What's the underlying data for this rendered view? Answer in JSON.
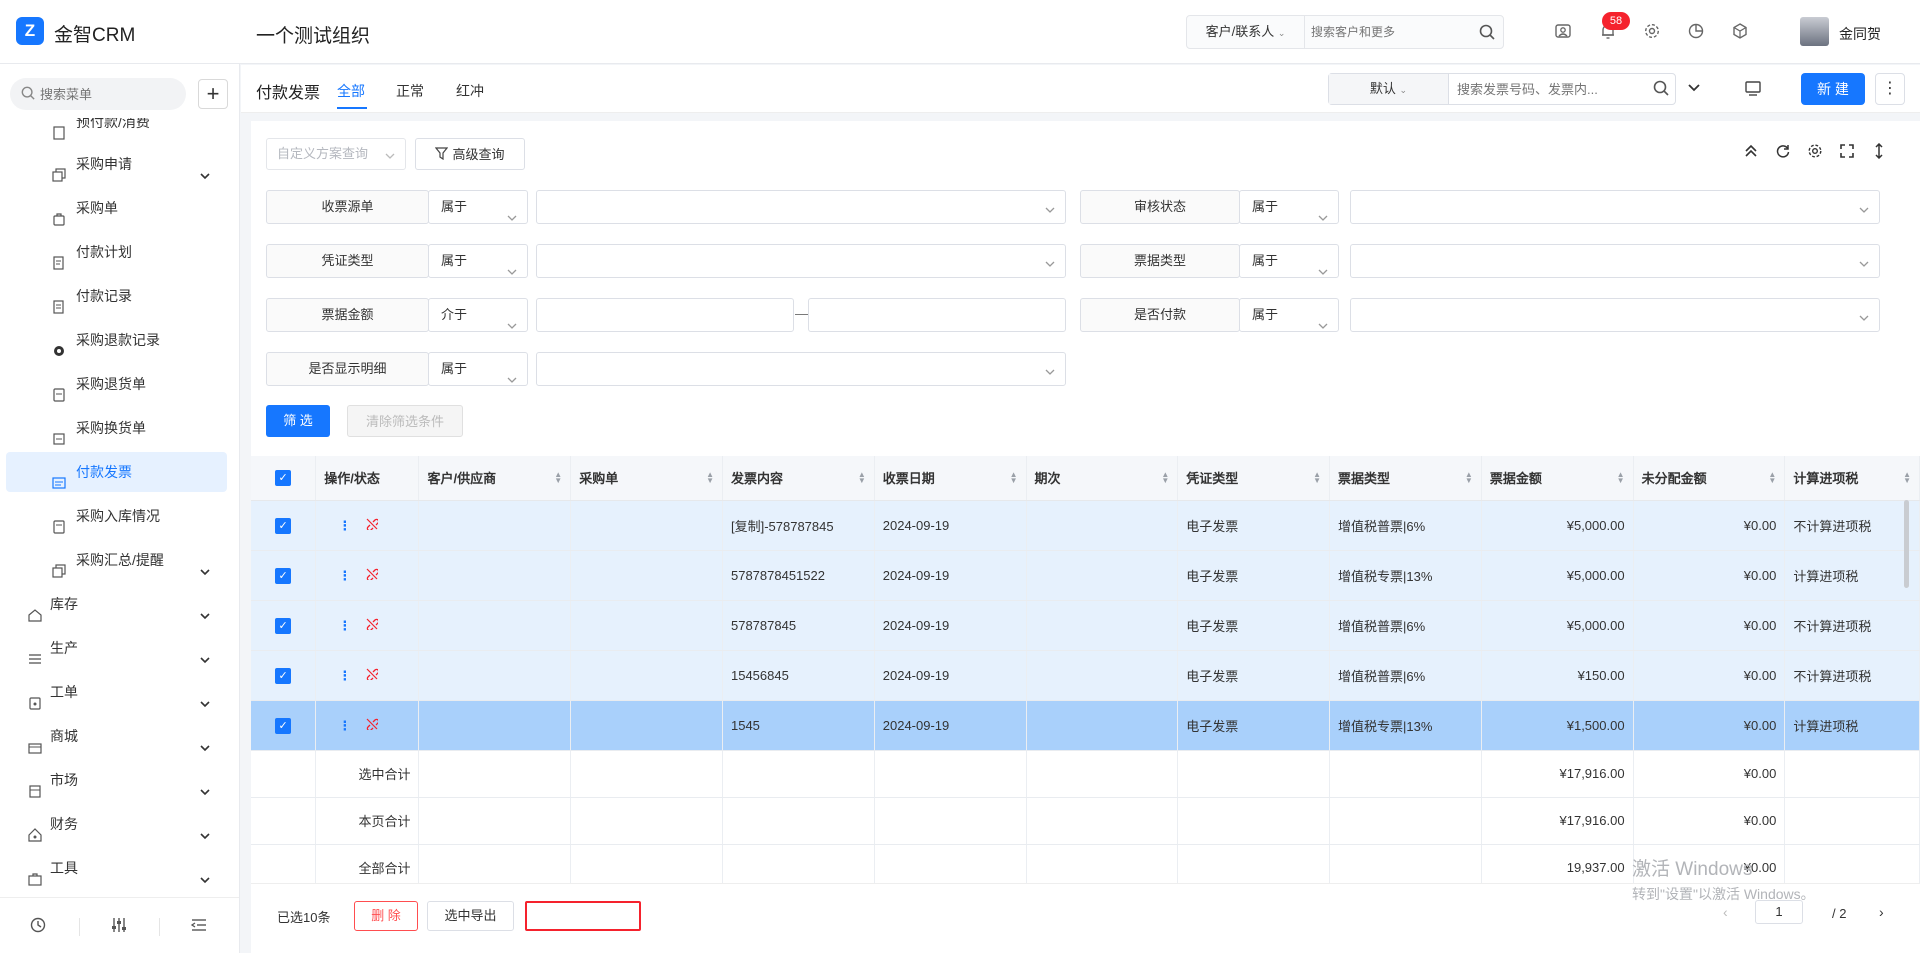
{
  "app": {
    "logo_glyph": "Z",
    "brand": "金智CRM",
    "org": "一个测试组织"
  },
  "global_search": {
    "scope": "客户/联系人",
    "placeholder": "搜索客户和更多"
  },
  "notifications": {
    "count": "58"
  },
  "user": {
    "name": "金同贺"
  },
  "sidebar": {
    "search_placeholder": "搜索菜单",
    "items": [
      {
        "label": "预付款/消费"
      },
      {
        "label": "采购申请"
      },
      {
        "label": "采购单"
      },
      {
        "label": "付款计划"
      },
      {
        "label": "付款记录"
      },
      {
        "label": "采购退款记录"
      },
      {
        "label": "采购退货单"
      },
      {
        "label": "采购换货单"
      },
      {
        "label": "付款发票"
      },
      {
        "label": "采购入库情况"
      },
      {
        "label": "采购汇总/提醒"
      },
      {
        "label": "库存"
      },
      {
        "label": "生产"
      },
      {
        "label": "工单"
      },
      {
        "label": "商城"
      },
      {
        "label": "市场"
      },
      {
        "label": "财务"
      },
      {
        "label": "工具"
      }
    ]
  },
  "page": {
    "title": "付款发票",
    "tabs": [
      {
        "label": "全部"
      },
      {
        "label": "正常"
      },
      {
        "label": "红冲"
      }
    ],
    "view": {
      "selected": "默认",
      "search_placeholder": "搜索发票号码、发票内..."
    },
    "new_button": "新 建",
    "more_button": "⋮"
  },
  "filter": {
    "scheme_placeholder": "自定义方案查询",
    "advanced": "高级查询",
    "rows": [
      {
        "label": "收票源单",
        "op": "属于"
      },
      {
        "label": "审核状态",
        "op": "属于"
      },
      {
        "label": "凭证类型",
        "op": "属于"
      },
      {
        "label": "票据类型",
        "op": "属于"
      },
      {
        "label": "票据金额",
        "op": "介于"
      },
      {
        "label": "是否付款",
        "op": "属于"
      },
      {
        "label": "是否显示明细",
        "op": "属于"
      }
    ],
    "range_sep": "—",
    "apply_button": "筛 选",
    "clear_button": "清除筛选条件"
  },
  "table": {
    "columns": [
      "操作/状态",
      "客户/供应商",
      "采购单",
      "发票内容",
      "收票日期",
      "期次",
      "凭证类型",
      "票据类型",
      "票据金额",
      "未分配金额",
      "计算进项税"
    ],
    "rows": [
      {
        "content": "[复制]-578787845",
        "date": "2024-09-19",
        "voucher": "电子发票",
        "invoice_type": "增值税普票|6%",
        "amount": "¥5,000.00",
        "unallocated": "¥0.00",
        "tax": "不计算进项税"
      },
      {
        "content": "5787878451522",
        "date": "2024-09-19",
        "voucher": "电子发票",
        "invoice_type": "增值税专票|13%",
        "amount": "¥5,000.00",
        "unallocated": "¥0.00",
        "tax": "计算进项税"
      },
      {
        "content": "578787845",
        "date": "2024-09-19",
        "voucher": "电子发票",
        "invoice_type": "增值税普票|6%",
        "amount": "¥5,000.00",
        "unallocated": "¥0.00",
        "tax": "不计算进项税"
      },
      {
        "content": "15456845",
        "date": "2024-09-19",
        "voucher": "电子发票",
        "invoice_type": "增值税普票|6%",
        "amount": "¥150.00",
        "unallocated": "¥0.00",
        "tax": "不计算进项税"
      },
      {
        "content": "1545",
        "date": "2024-09-19",
        "voucher": "电子发票",
        "invoice_type": "增值税专票|13%",
        "amount": "¥1,500.00",
        "unallocated": "¥0.00",
        "tax": "计算进项税"
      }
    ],
    "summary": [
      {
        "label": "选中合计",
        "amount": "¥17,916.00",
        "unallocated": "¥0.00"
      },
      {
        "label": "本页合计",
        "amount": "¥17,916.00",
        "unallocated": "¥0.00"
      },
      {
        "label": "全部合计",
        "amount": "19,937.00",
        "unallocated": "¥0.00"
      }
    ]
  },
  "footer": {
    "selected_count": "已选10条",
    "delete_button": "删 除",
    "export_button": "选中导出",
    "page_current": "1",
    "page_total": "/ 2"
  },
  "watermark": {
    "line1": "激活 Windows",
    "line2": "转到\"设置\"以激活 Windows。"
  },
  "colors": {
    "accent": "#1677ff",
    "danger": "#f5222d",
    "selected_row": "#e6f1fd",
    "current_row": "#a9d0fb"
  }
}
